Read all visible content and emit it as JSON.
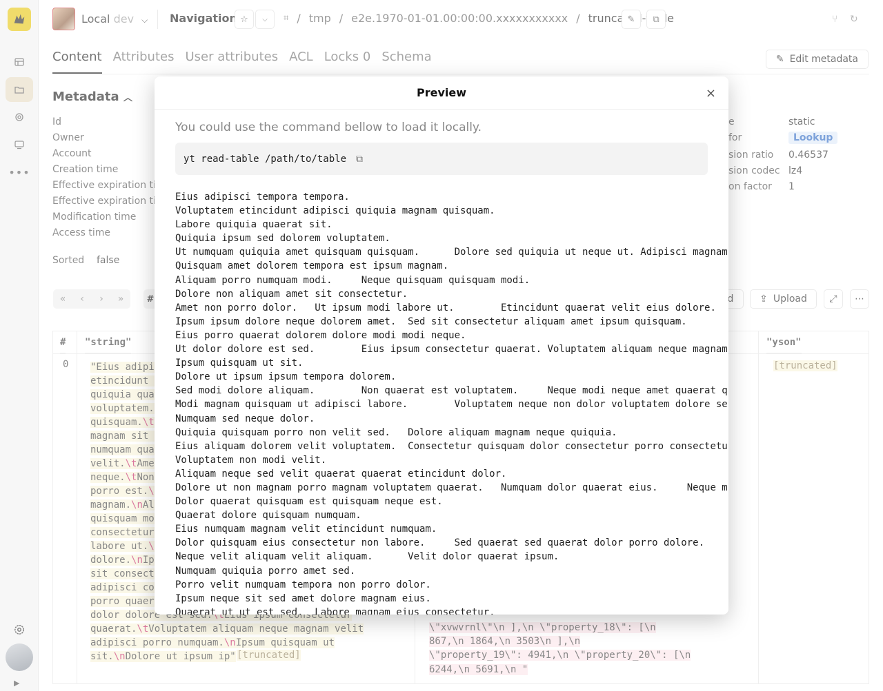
{
  "cluster": {
    "name": "Local",
    "env": "dev"
  },
  "nav_title": "Navigation",
  "breadcrumbs": [
    "tmp",
    "e2e.1970-01-01.00:00:00.xxxxxxxxxxx",
    "truncated-table"
  ],
  "tabs": [
    {
      "label": "Content",
      "active": true
    },
    {
      "label": "Attributes"
    },
    {
      "label": "User attributes"
    },
    {
      "label": "ACL"
    },
    {
      "label": "Locks",
      "count": "0"
    },
    {
      "label": "Schema"
    }
  ],
  "edit_metadata_label": "Edit metadata",
  "metadata": {
    "title": "Metadata",
    "left_keys": [
      "Id",
      "Owner",
      "Account",
      "Creation time",
      "Effective expiration tim",
      "Effective expiration tim",
      "Modification time",
      "Access time"
    ],
    "right_rows": [
      {
        "key": "e",
        "value": "static"
      },
      {
        "key": "for",
        "value": "Lookup"
      },
      {
        "key": "sion ratio",
        "value": "0.46537"
      },
      {
        "key": "sion codec",
        "value": "lz4"
      },
      {
        "key": "on factor",
        "value": "1"
      }
    ],
    "sorted_key": "Sorted",
    "sorted_value": "false"
  },
  "toolbar": {
    "pager": [
      "«",
      "‹",
      "›",
      "»"
    ],
    "hash": "#",
    "download_fragment": "d",
    "upload_label": "Upload"
  },
  "table": {
    "headers": {
      "index": "#",
      "string": "\"string\"",
      "yson": "\"yson\""
    },
    "row_index": "0",
    "string_fragments": [
      "\"Eius adipis",
      "etincidunt a",
      "quiquia quae",
      "voluptatem.\\",
      "quisquam.\\tD",
      "magnam sit a",
      "numquam quae",
      "velit.\\tAmet",
      "neque.\\tNon ",
      "porro est.\\n",
      "magnam.\\nAli",
      "quisquam mod",
      "consectetur.",
      "labore ut.\\t",
      "dolore.\\nIps",
      "sit consecte",
      "adipisci con",
      "porro quaera",
      "dolor dolore est sed.\\tEius ipsum consectetur",
      "quaerat.\\tVoluptatem aliquam neque magnam velit",
      "adipisci porro numquam.\\nIpsum quisquam ut",
      "sit.\\nDolore ut ipsum ip\""
    ],
    "truncated_label": "[truncated]",
    "mid_fragments": [
      "\\\"xvwvrnl\\\"\\n    ],\\n    \\\"property_18\\\": [\\n",
      "867,\\n        1864,\\n        3503\\n    ],\\n",
      "\\\"property_19\\\": 4941,\\n    \\\"property_20\\\": [\\n",
      "6244,\\n        5691,\\n    \""
    ]
  },
  "modal": {
    "title": "Preview",
    "close": "×",
    "hint": "You could use the command bellow to load it locally.",
    "command": "yt read-table /path/to/table",
    "lines": [
      "Eius adipisci tempora tempora.",
      "Voluptatem etincidunt adipisci quiquia magnam quisquam.",
      "Labore quiquia quaerat sit.",
      "Quiquia ipsum sed dolorem voluptatem.",
      "Ut numquam quiquia amet quisquam quisquam.      Dolore sed quiquia ut neque ut. Adipisci magnam",
      "Quisquam amet dolorem tempora est ipsum magnam.",
      "Aliquam porro numquam modi.     Neque quisquam quisquam modi.",
      "Dolore non aliquam amet sit consectetur.",
      "Amet non porro dolor.   Ut ipsum modi labore ut.        Etincidunt quaerat velit eius dolore.",
      "Ipsum ipsum dolore neque dolorem amet.  Sed sit consectetur aliquam amet ipsum quisquam.",
      "Eius porro quaerat dolorem dolore modi modi neque.",
      "Ut dolor dolore est sed.        Eius ipsum consectetur quaerat. Voluptatem aliquam neque magnam",
      "Ipsum quisquam ut sit.",
      "Dolore ut ipsum ipsum tempora dolorem.",
      "Sed modi dolore aliquam.        Non quaerat est voluptatem.     Neque modi neque amet quaerat q",
      "Modi magnam quisquam ut adipisci labore.        Voluptatem neque non dolor voluptatem dolore se",
      "Numquam sed neque dolor.",
      "Quiquia quisquam porro non velit sed.   Dolore aliquam magnam neque quiquia.",
      "Eius aliquam dolorem velit voluptatem.  Consectetur quisquam dolor consectetur porro consectetu",
      "Voluptatem non modi velit.",
      "Aliquam neque sed velit quaerat quaerat etincidunt dolor.",
      "Dolore ut non magnam porro magnam voluptatem quaerat.   Numquam dolor quaerat eius.     Neque m",
      "Dolor quaerat quisquam est quisquam neque est.",
      "Quaerat dolore quisquam numquam.",
      "Eius numquam magnam velit etincidunt numquam.",
      "Dolor quisquam eius consectetur non labore.     Sed quaerat sed quaerat dolor porro dolore.",
      "Neque velit aliquam velit aliquam.      Velit dolor quaerat ipsum.",
      "Numquam quiquia porro amet sed.",
      "Porro velit numquam tempora non porro dolor.",
      "Ipsum neque sit sed amet dolore magnam eius.",
      "Quaerat ut ut est sed.  Labore magnam eius consectetur."
    ]
  }
}
